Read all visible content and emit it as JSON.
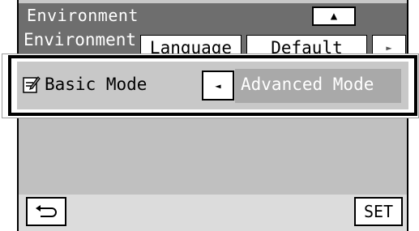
{
  "header": {
    "title": "Environment",
    "scroll_up_icon": "up-triangle-icon"
  },
  "tabs": [
    {
      "label": "Environment",
      "active": true
    },
    {
      "label": "Language",
      "active": false
    },
    {
      "label": "Default",
      "active": false
    },
    {
      "label": "►",
      "active": false
    }
  ],
  "mode_setting": {
    "current_label": "Basic Mode",
    "current_icon": "note-pencil-icon",
    "prev_icon": "left-triangle-icon",
    "option_label": "Advanced Mode"
  },
  "footer": {
    "back_icon": "return-arrow-icon",
    "set_label": "SET"
  }
}
